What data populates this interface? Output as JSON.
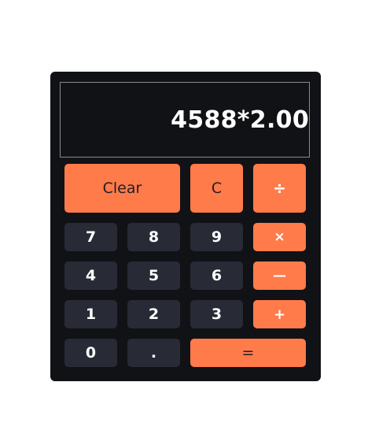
{
  "display": {
    "value": "4588*2.00"
  },
  "buttons": {
    "clear": "Clear",
    "backspace": "C",
    "divide": "÷",
    "multiply": "×",
    "subtract": "—",
    "add": "+",
    "equals": "=",
    "decimal": ".",
    "digits": [
      "0",
      "1",
      "2",
      "3",
      "4",
      "5",
      "6",
      "7",
      "8",
      "9"
    ]
  },
  "colors": {
    "body": "#111216",
    "accent": "#ff7b4a",
    "number_key": "#282a36",
    "display_border": "#8a8b90"
  }
}
